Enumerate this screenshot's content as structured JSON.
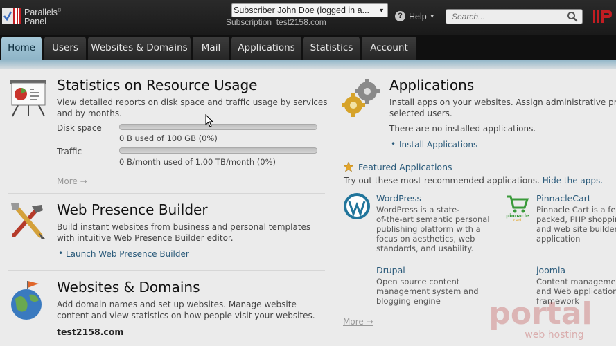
{
  "header": {
    "logo_line1": "Parallels",
    "logo_sup": "®",
    "logo_line2": "Panel",
    "subscriber_select": "Subscriber  John Doe (logged in a...",
    "subscription_label": "Subscription",
    "subscription_value": "test2158.com",
    "help_label": "Help",
    "search_placeholder": "Search..."
  },
  "tabs": [
    {
      "label": "Home",
      "active": true
    },
    {
      "label": "Users"
    },
    {
      "label": "Websites & Domains"
    },
    {
      "label": "Mail"
    },
    {
      "label": "Applications"
    },
    {
      "label": "Statistics"
    },
    {
      "label": "Account"
    }
  ],
  "stats": {
    "title": "Statistics on Resource Usage",
    "desc": "View detailed reports on disk space and traffic usage by services and by months.",
    "disk_label": "Disk space",
    "disk_value": "0 B used of 100 GB (0%)",
    "disk_fraction": 0,
    "traffic_label": "Traffic",
    "traffic_value": "0 B/month used of 1.00 TB/month (0%)",
    "traffic_fraction": 0,
    "more": "More →"
  },
  "wpb": {
    "title": "Web Presence Builder",
    "desc": "Build instant websites from business and personal templates with intuitive Web Presence Builder editor.",
    "link": "Launch Web Presence Builder"
  },
  "wd": {
    "title": "Websites & Domains",
    "desc": "Add domain names and set up websites. Manage website content and view statistics on how people visit your websites.",
    "domain": "test2158.com"
  },
  "apps": {
    "title": "Applications",
    "desc_line1": "Install apps on your websites. Assign administrative pri",
    "desc_line2": "selected users.",
    "none": "There are no installed applications.",
    "install_link": "Install Applications",
    "featured_title": "Featured Applications",
    "featured_desc": "Try out these most recommended applications.",
    "hide_link": "Hide the apps.",
    "items": [
      {
        "name": "WordPress",
        "lines": [
          "WordPress is a state-",
          "of-the-art semantic personal",
          "publishing platform with a",
          "focus on aesthetics, web",
          "standards, and usability."
        ]
      },
      {
        "name": "PinnacleCart",
        "lines": [
          "Pinnacle Cart is a fea",
          "packed, PHP shopping",
          "and web site builder",
          "application"
        ]
      },
      {
        "name": "Drupal",
        "lines": [
          "Open source content",
          "management system and",
          "blogging engine"
        ]
      },
      {
        "name": "joomla",
        "lines": [
          "Content managemen",
          "and Web application",
          "framework"
        ]
      }
    ],
    "more": "More →"
  },
  "watermark": {
    "line1": "portal",
    "line2": "web hosting"
  },
  "icon_names": [
    "parallels-logo-icon",
    "help-icon",
    "search-icon",
    "presentation-board-icon",
    "tools-icon",
    "globe-flag-icon",
    "gears-icon",
    "star-icon",
    "wordpress-icon",
    "pinnacle-cart-icon",
    "cursor-icon"
  ]
}
